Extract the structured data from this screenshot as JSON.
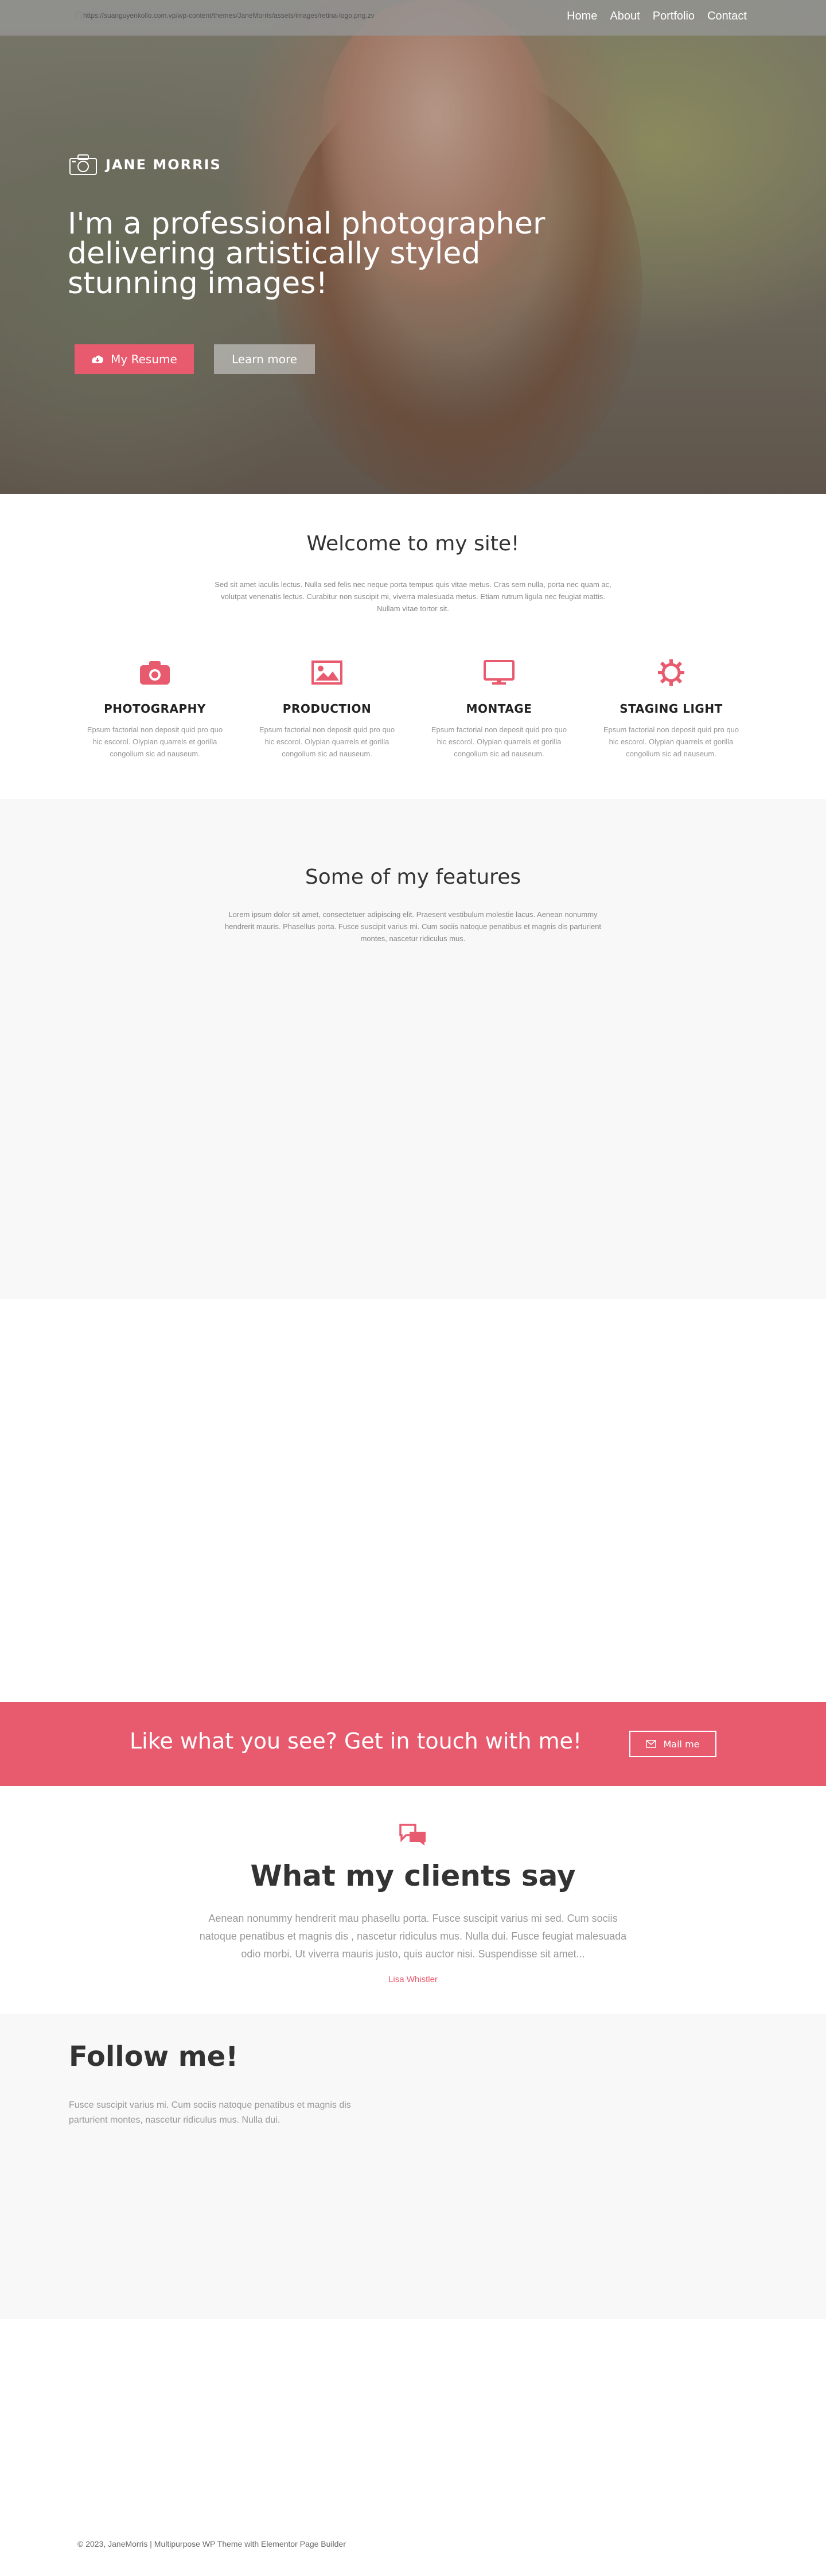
{
  "nav": {
    "logo_alt": "https://suanguyenkollo.com.vp/wp-content/themes/JaneMorris/assets/images/retina-logo.png.zv",
    "items": [
      "Home",
      "About",
      "Portfolio",
      "Contact"
    ]
  },
  "hero": {
    "brand": "JANE MORRIS",
    "headline": "I'm a professional photographer delivering artistically styled stunning images!",
    "resume_button": "My Resume",
    "learn_button": "Learn more"
  },
  "welcome": {
    "title": "Welcome to my site!",
    "intro": "Sed sit amet iaculis lectus. Nulla sed felis nec neque porta tempus quis vitae metus. Cras sem nulla, porta nec quam ac, volutpat venenatis lectus. Curabitur non suscipit mi, viverra malesuada metus. Etiam rutrum ligula nec feugiat mattis. Nullam vitae tortor sit."
  },
  "services": [
    {
      "icon": "camera-icon",
      "title": "PHOTOGRAPHY",
      "text": "Epsum factorial non deposit quid pro quo hic escorol. Olypian quarrels et gorilla congolium sic ad nauseum."
    },
    {
      "icon": "image-icon",
      "title": "PRODUCTION",
      "text": "Epsum factorial non deposit quid pro quo hic escorol. Olypian quarrels et gorilla congolium sic ad nauseum."
    },
    {
      "icon": "monitor-icon",
      "title": "MONTAGE",
      "text": "Epsum factorial non deposit quid pro quo hic escorol. Olypian quarrels et gorilla congolium sic ad nauseum."
    },
    {
      "icon": "gear-icon",
      "title": "STAGING LIGHT",
      "text": "Epsum factorial non deposit quid pro quo hic escorol. Olypian quarrels et gorilla congolium sic ad nauseum."
    }
  ],
  "features": {
    "title": "Some of my features",
    "text": "Lorem ipsum dolor sit amet, consectetuer adipiscing elit. Praesent vestibulum molestie lacus. Aenean nonummy hendrerit mauris. Phasellus porta. Fusce suscipit varius mi. Cum sociis natoque penatibus et magnis dis parturient montes, nascetur ridiculus mus."
  },
  "cta": {
    "text": "Like what you see? Get in touch with me!",
    "button": "Mail me"
  },
  "clients": {
    "title": "What my clients say",
    "quote": "Aenean nonummy hendrerit mau phasellu porta. Fusce suscipit varius mi sed. Cum sociis natoque penatibus et magnis dis , nascetur ridiculus mus. Nulla dui. Fusce feugiat malesuada odio morbi. Ut viverra mauris justo, quis auctor nisi. Suspendisse sit amet...",
    "author": "Lisa Whistler"
  },
  "follow": {
    "title": "Follow me!",
    "text": "Fusce suscipit varius mi. Cum sociis natoque penatibus et magnis dis parturient montes, nascetur ridiculus mus. Nulla dui."
  },
  "footer": {
    "text": "© 2023, JaneMorris | Multipurpose WP Theme with Elementor Page Builder"
  },
  "colors": {
    "accent": "#e85b6f",
    "light_bg": "#f8f8f8"
  }
}
